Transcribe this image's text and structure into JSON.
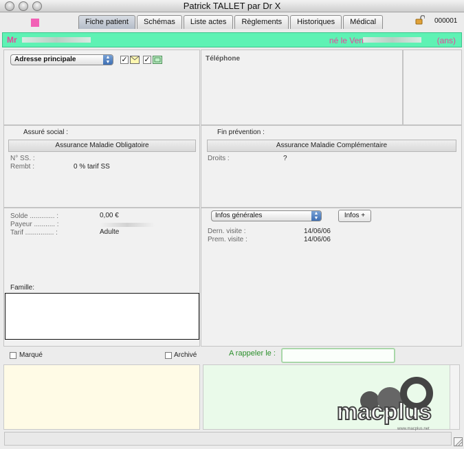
{
  "window": {
    "title": "Patrick TALLET par Dr X"
  },
  "tabs": [
    {
      "label": "Fiche patient",
      "active": true
    },
    {
      "label": "Schémas"
    },
    {
      "label": "Liste actes"
    },
    {
      "label": "Règlements"
    },
    {
      "label": "Historiques"
    },
    {
      "label": "Médical"
    }
  ],
  "record_number": "000001",
  "patient": {
    "civility": "Mr",
    "born_prefix": "né  le Ven",
    "age_suffix": "ans)"
  },
  "address": {
    "type_select": "Adresse principale"
  },
  "phone": {
    "label": "Téléphone"
  },
  "insurance": {
    "assure_label": "Assuré social :",
    "amo_button": "Assurance Maladie Obligatoire",
    "nss_label": "N° SS. :",
    "rembt_label": "Rembt :",
    "rembt_value": "0 % tarif SS",
    "fin_prevention_label": "Fin prévention :",
    "amc_button": "Assurance Maladie Complémentaire",
    "droits_label": "Droits :",
    "droits_value": "?"
  },
  "billing": {
    "solde_label": "Solde ............. :",
    "solde_value": "0,00 €",
    "payeur_label": "Payeur ........... :",
    "tarif_label": "Tarif ............... :",
    "tarif_value": "Adulte",
    "famille_label": "Famille:"
  },
  "infos": {
    "select": "Infos générales",
    "more_button": "Infos +",
    "dern_label": "Dern. visite :",
    "dern_value": "14/06/06",
    "prem_label": "Prem. visite :",
    "prem_value": "14/06/06"
  },
  "flags": {
    "marque": "Marqué",
    "archive": "Archivé",
    "rappel_label": "A rappeler le :"
  },
  "logo": {
    "text": "macplus",
    "url": "www.macplus.net"
  },
  "colors": {
    "banner": "#5ef2b4",
    "name_pink": "#e8449a",
    "rappel_green": "#2a8e2a"
  }
}
